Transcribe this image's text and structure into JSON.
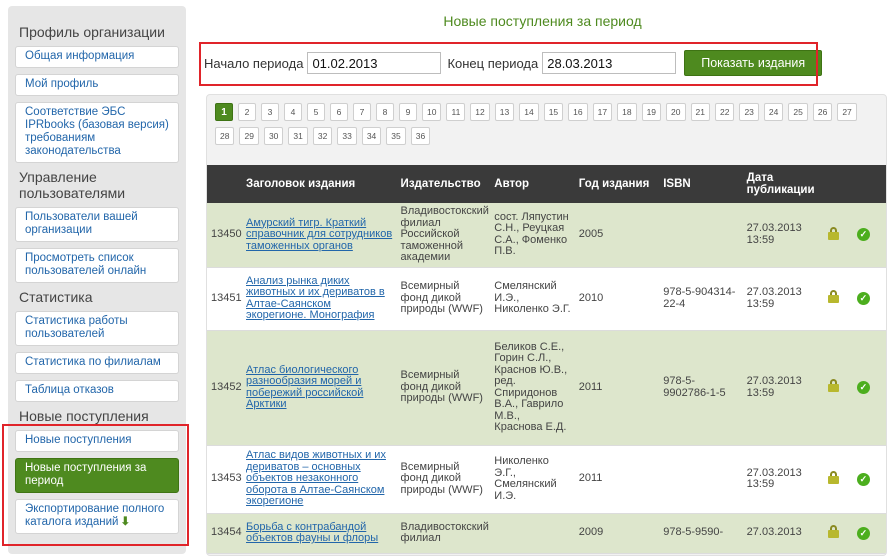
{
  "sidebar": {
    "sections": [
      {
        "title": "Профиль организации",
        "items": [
          "Общая информация",
          "Мой профиль",
          "Соответствие ЭБС IPRbooks (базовая версия) требованиям законодательства"
        ]
      },
      {
        "title": "Управление пользователями",
        "items": [
          "Пользователи вашей организации",
          "Просмотреть список пользователей онлайн"
        ]
      },
      {
        "title": "Статистика",
        "items": [
          "Статистика работы пользователей",
          "Статистика по филиалам",
          "Таблица отказов"
        ]
      },
      {
        "title": "Новые поступления",
        "items": [
          "Новые поступления",
          "Новые поступления за период",
          "Экспортирование полного каталога изданий"
        ]
      }
    ]
  },
  "main": {
    "title": "Новые поступления за период",
    "period": {
      "start_label": "Начало периода",
      "start_value": "01.02.2013",
      "end_label": "Конец периода",
      "end_value": "28.03.2013",
      "button": "Показать издания"
    },
    "pager": [
      "1",
      "2",
      "3",
      "4",
      "5",
      "6",
      "7",
      "8",
      "9",
      "10",
      "11",
      "12",
      "13",
      "14",
      "15",
      "16",
      "17",
      "18",
      "19",
      "20",
      "21",
      "22",
      "23",
      "24",
      "25",
      "26",
      "27",
      "28",
      "29",
      "30",
      "31",
      "32",
      "33",
      "34",
      "35",
      "36"
    ],
    "current_page": "1",
    "table": {
      "headers": [
        "",
        "Заголовок издания",
        "Издательство",
        "Автор",
        "Год издания",
        "ISBN",
        "Дата публикации",
        "",
        ""
      ],
      "rows": [
        {
          "id": "13450",
          "title": "Амурский тигр. Краткий справочник для сотрудников таможенных органов",
          "publisher": "Владивостокский филиал Российской таможенной академии",
          "author": "сост. Ляпустин С.Н., Реуцкая С.А., Фоменко П.В.",
          "year": "2005",
          "isbn": "",
          "date": "27.03.2013 13:59"
        },
        {
          "id": "13451",
          "title": "Анализ рынка диких животных и их дериватов в Алтае-Саянском экорегионе. Монография",
          "publisher": "Всемирный фонд дикой природы (WWF)",
          "author": "Смелянский И.Э., Николенко Э.Г.",
          "year": "2010",
          "isbn": "978-5-904314-22-4",
          "date": "27.03.2013 13:59"
        },
        {
          "id": "13452",
          "title": "Атлас биологического разнообразия морей и побережий российской Арктики",
          "publisher": "Всемирный фонд дикой природы (WWF)",
          "author": "Беликов С.Е., Горин С.Л., Краснов Ю.В., ред. Спиридонов В.А., Гаврило М.В., Краснова Е.Д.",
          "year": "2011",
          "isbn": "978-5-9902786-1-5",
          "date": "27.03.2013 13:59"
        },
        {
          "id": "13453",
          "title": "Атлас видов животных и их дериватов – основных объектов незаконного оборота в Алтае-Саянском экорегионе",
          "publisher": "Всемирный фонд дикой природы (WWF)",
          "author": "Николенко Э.Г., Смелянский И.Э.",
          "year": "2011",
          "isbn": "",
          "date": "27.03.2013 13:59"
        },
        {
          "id": "13454",
          "title": "Борьба с контрабандой объектов фауны и флоры",
          "publisher": "Владивостокский филиал",
          "author": "",
          "year": "2009",
          "isbn": "978-5-9590-",
          "date": "27.03.2013"
        }
      ]
    }
  },
  "colors": {
    "accent_green": "#4e8a1f",
    "highlight_red": "#e0242a",
    "row_green": "#dde6cc",
    "header_dark": "#3a3a3a"
  }
}
